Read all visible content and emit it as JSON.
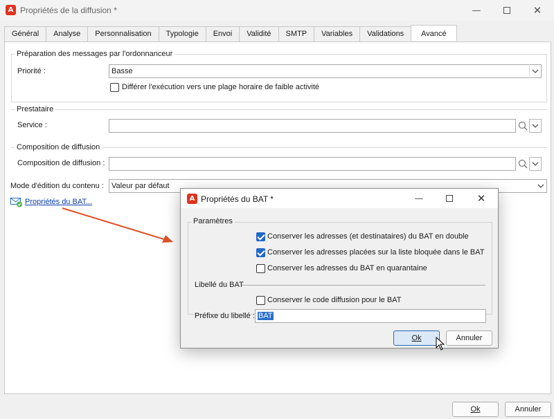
{
  "window": {
    "title": "Propriétés de la diffusion *",
    "app_icon": "adobe-campaign-icon",
    "controls": [
      "minimize-icon",
      "maximize-icon",
      "close-icon"
    ]
  },
  "tabs": [
    {
      "label": "Général"
    },
    {
      "label": "Analyse"
    },
    {
      "label": "Personnalisation"
    },
    {
      "label": "Typologie"
    },
    {
      "label": "Envoi"
    },
    {
      "label": "Validité"
    },
    {
      "label": "SMTP"
    },
    {
      "label": "Variables"
    },
    {
      "label": "Validations"
    },
    {
      "label": "Avancé",
      "active": true
    }
  ],
  "preparation": {
    "title": "Préparation des messages par l'ordonnanceur",
    "priority_label": "Priorité :",
    "priority_value": "Basse",
    "defer_label": "Différer l'exécution vers une plage horaire de faible activité",
    "defer_checked": false
  },
  "provider": {
    "title": "Prestataire",
    "service_label": "Service :",
    "service_value": ""
  },
  "composition": {
    "title": "Composition de diffusion",
    "label": "Composition de diffusion :",
    "value": ""
  },
  "edit_mode": {
    "label": "Mode d'édition du contenu :",
    "value": "Valeur par défaut"
  },
  "bat_link": "Propriétés du BAT...",
  "main_buttons": {
    "ok": "Ok",
    "cancel": "Annuler"
  },
  "dialog": {
    "title": "Propriétés du BAT *",
    "params_title": "Paramètres",
    "options": [
      {
        "label": "Conserver les adresses (et destinataires) du BAT en double",
        "checked": true
      },
      {
        "label": "Conserver les adresses placées sur la liste bloquée dans le BAT",
        "checked": true
      },
      {
        "label": "Conserver les adresses du BAT en quarantaine",
        "checked": false
      }
    ],
    "label_section_title": "Libellé du BAT",
    "keep_code_label": "Conserver le code diffusion pour le BAT",
    "keep_code_checked": false,
    "prefix_label": "Préfixe du libellé :",
    "prefix_value": "BAT",
    "ok": "Ok",
    "cancel": "Annuler"
  },
  "colors": {
    "accent": "#2468c8",
    "annotation_arrow": "#e0502a",
    "app_icon": "#e0321e"
  }
}
